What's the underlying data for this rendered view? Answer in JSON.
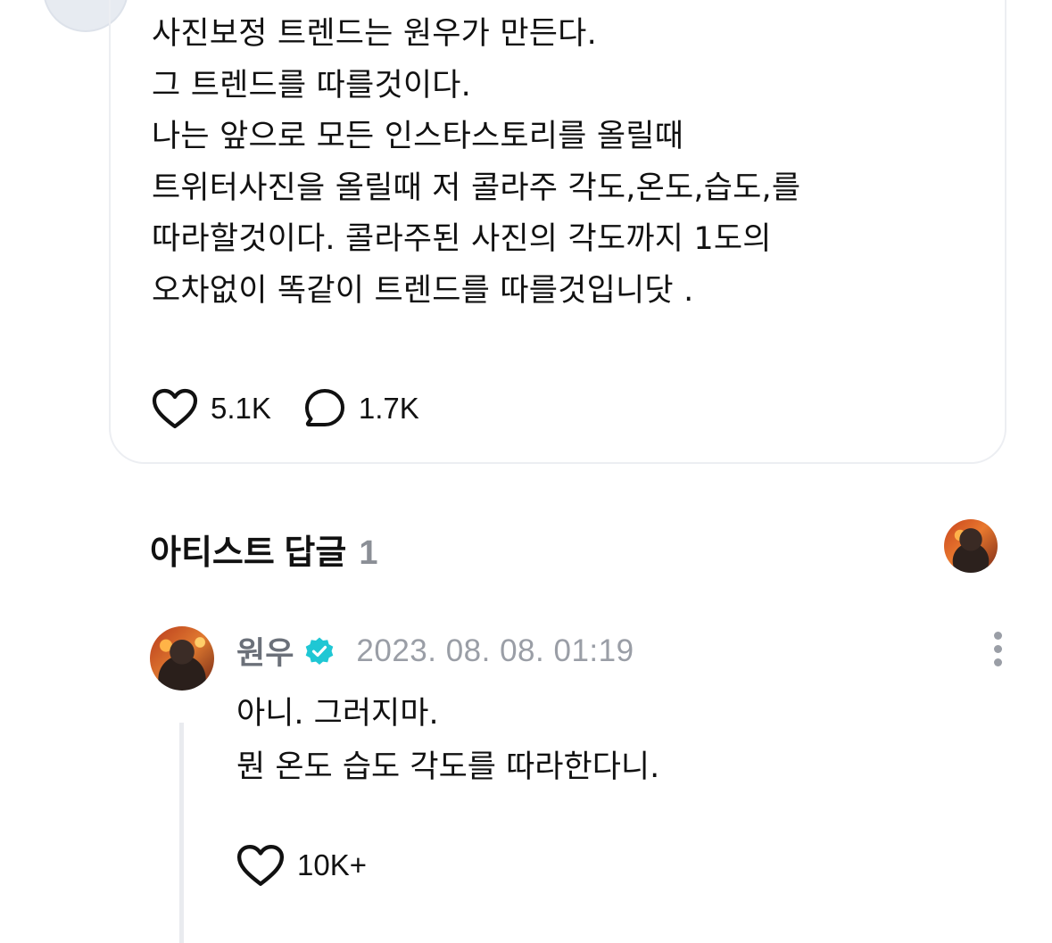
{
  "post": {
    "lines": [
      "사진보정 트렌드는 원우가 만든다.",
      "그 트렌드를 따를것이다.",
      "나는 앞으로 모든 인스타스토리를 올릴때",
      "트위터사진을 올릴때 저 콜라주 각도,온도,습도,를",
      "따라할것이다. 콜라주된 사진의 각도까지 1도의",
      "오차없이 똑같이 트렌드를 따를것입니닷 ."
    ],
    "like_count": "5.1K",
    "comment_count": "1.7K"
  },
  "artist_replies": {
    "title": "아티스트 답글",
    "count": "1"
  },
  "comment": {
    "author": "원우",
    "date": "2023. 08. 08. 01:19",
    "lines": [
      "아니. 그러지마.",
      "뭔 온도 습도 각도를 따라한다니."
    ],
    "like_count": "10K+"
  },
  "colors": {
    "verified": "#1fc7d4",
    "muted_text": "#9a9ea6",
    "card_border": "#eceef2"
  },
  "icons": [
    "heart-icon",
    "comment-bubble-icon",
    "verified-badge-icon",
    "more-options-icon"
  ]
}
